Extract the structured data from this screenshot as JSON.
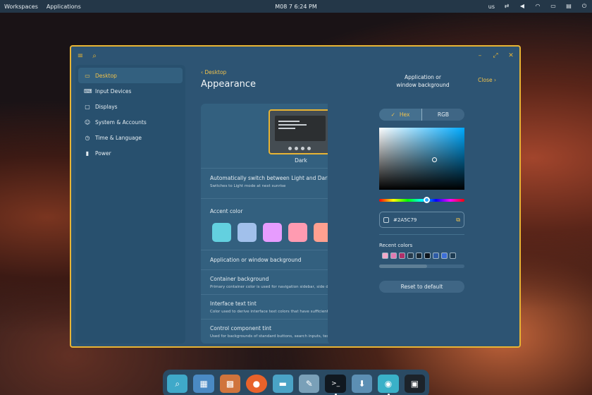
{
  "topbar": {
    "workspaces": "Workspaces",
    "applications": "Applications",
    "clock": "M08 7 6:24 PM",
    "keyboard_layout": "us",
    "tray_icons": [
      "network-icon",
      "volume-icon",
      "wifi-icon",
      "battery-icon",
      "notifications-icon",
      "power-icon"
    ]
  },
  "window": {
    "accent": "#e8b434",
    "controls": [
      "minimize",
      "maximize",
      "close"
    ]
  },
  "sidebar": {
    "items": [
      {
        "label": "Desktop",
        "icon": "desktop-icon",
        "active": true
      },
      {
        "label": "Input Devices",
        "icon": "keyboard-icon"
      },
      {
        "label": "Displays",
        "icon": "display-icon"
      },
      {
        "label": "System & Accounts",
        "icon": "users-icon"
      },
      {
        "label": "Time & Language",
        "icon": "clock-icon"
      },
      {
        "label": "Power",
        "icon": "battery-icon"
      }
    ]
  },
  "main": {
    "back_label": "Desktop",
    "title": "Appearance",
    "theme_label": "Dark",
    "auto_switch_title": "Automatically switch between Light and Dark m",
    "auto_switch_sub": "Switches to Light mode at next sunrise",
    "accent_label": "Accent color",
    "accent_colors": [
      "#63d0df",
      "#a1c0eb",
      "#e79cfe",
      "#ff9bb1",
      "#ffa090"
    ],
    "app_bg_label": "Application or window background",
    "container_bg_title": "Container background",
    "container_bg_sub": "Primary container color is used for navigation sidebar, side drawer",
    "text_tint_title": "Interface text tint",
    "text_tint_sub": "Color used to derive interface text colors that have sufficient contr",
    "control_tint_title": "Control component tint",
    "control_tint_sub": "Used for backgrounds of standard buttons, search inputs, text inpu"
  },
  "panel": {
    "title_line1": "Application or",
    "title_line2": "window background",
    "close_label": "Close",
    "hex_tab": "Hex",
    "rgb_tab": "RGB",
    "hex_value": "#2A5C79",
    "recent_label": "Recent colors",
    "recent_colors": [
      "#f4a8c8",
      "#e07bb0",
      "#b0306a",
      "#263b4c",
      "#1b2a36",
      "#0d151d",
      "#2d5ba6",
      "#3d6fd8",
      "#1d3b52"
    ],
    "reset_label": "Reset to default"
  },
  "dock": {
    "apps": [
      {
        "name": "files-search-icon",
        "color": "#3fa9c9",
        "glyph": "⌕",
        "running": false
      },
      {
        "name": "workspaces-icon",
        "color": "#4a8ac4",
        "glyph": "▦",
        "running": false
      },
      {
        "name": "app-grid-icon",
        "color": "#d0743c",
        "glyph": "▩",
        "running": false
      },
      {
        "name": "firefox-icon",
        "color": "#e8622a",
        "glyph": "●",
        "running": false
      },
      {
        "name": "folder-icon",
        "color": "#4aa3c6",
        "glyph": "▬",
        "running": false
      },
      {
        "name": "text-editor-icon",
        "color": "#7aa0b8",
        "glyph": "✎",
        "running": false
      },
      {
        "name": "terminal-icon",
        "color": "#101820",
        "glyph": ">_",
        "running": true
      },
      {
        "name": "store-icon",
        "color": "#5c8fb4",
        "glyph": "⬇",
        "running": false
      },
      {
        "name": "settings-icon",
        "color": "#3ab1c8",
        "glyph": "◉",
        "running": true
      },
      {
        "name": "screenshot-icon",
        "color": "#1c232a",
        "glyph": "▣",
        "running": false
      }
    ]
  }
}
